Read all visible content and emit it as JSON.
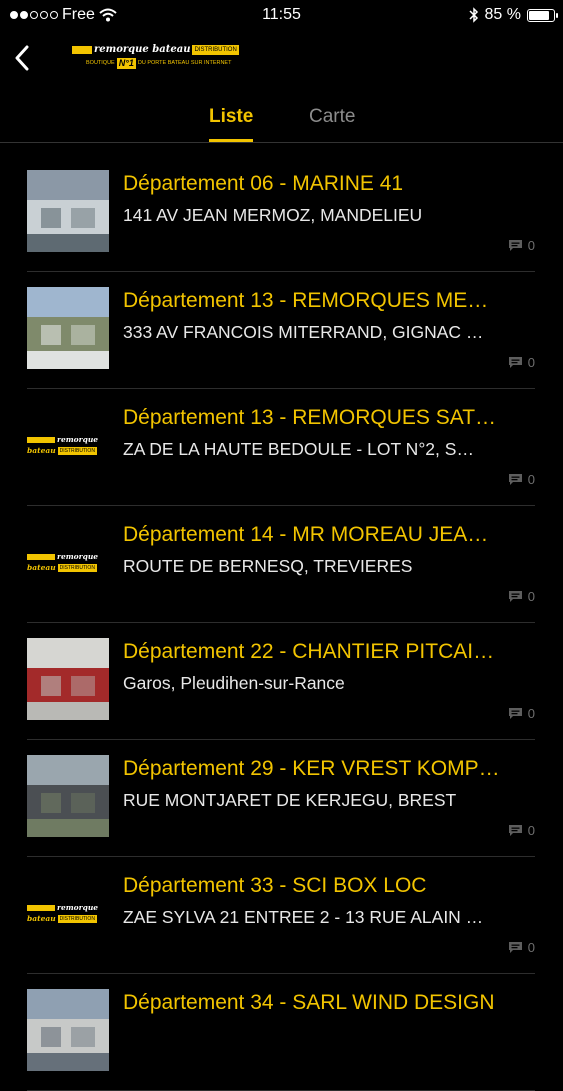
{
  "status": {
    "carrier": "Free",
    "time": "11:55",
    "battery": "85 %",
    "battery_level": 0.85
  },
  "header": {
    "back_icon": "chevron-left-icon",
    "logo": {
      "script": "remorque bateau",
      "distribution": "DISTRIBUTION",
      "boutique": "BOUTIQUE",
      "number": "N°1",
      "tagline": "DU PORTE BATEAU SUR INTERNET"
    }
  },
  "tabs": [
    {
      "label": "Liste",
      "active": true
    },
    {
      "label": "Carte",
      "active": false
    }
  ],
  "colors": {
    "accent": "#f2c400",
    "background": "#000000",
    "muted": "#8c8c8c"
  },
  "items": [
    {
      "title": "Département 06 - MARINE 41",
      "address": "141 AV JEAN MERMOZ, MANDELIEU",
      "comments": "0",
      "thumb": "photo"
    },
    {
      "title": "Département 13 - REMORQUES ME…",
      "address": "333 AV FRANCOIS MITERRAND, GIGNAC …",
      "comments": "0",
      "thumb": "photo"
    },
    {
      "title": "Département 13 - REMORQUES SAT…",
      "address": "ZA DE LA HAUTE BEDOULE - LOT N°2, S…",
      "comments": "0",
      "thumb": "logo"
    },
    {
      "title": "Département 14 - MR MOREAU JEA…",
      "address": "ROUTE DE BERNESQ, TREVIERES",
      "comments": "0",
      "thumb": "logo"
    },
    {
      "title": "Département 22 - CHANTIER PITCAI…",
      "address": "Garos, Pleudihen-sur-Rance",
      "comments": "0",
      "thumb": "photo"
    },
    {
      "title": "Département 29 - KER VREST KOMP…",
      "address": "RUE MONTJARET DE KERJEGU, BREST",
      "comments": "0",
      "thumb": "photo"
    },
    {
      "title": "Département 33 - SCI BOX LOC",
      "address": "ZAE SYLVA 21 ENTREE 2 - 13 RUE ALAIN …",
      "comments": "0",
      "thumb": "logo"
    },
    {
      "title": "Département 34 - SARL WIND DESIGN",
      "address": "",
      "comments": "",
      "thumb": "photo"
    }
  ],
  "mini_logo": {
    "script1": "remorque",
    "script2": "bateau",
    "dist": "DISTRIBUTION"
  }
}
